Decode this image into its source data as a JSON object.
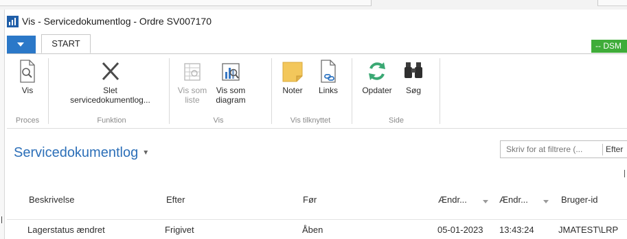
{
  "window": {
    "title": "Vis - Servicedokumentlog - Ordre SV007170"
  },
  "ribbon": {
    "tab": "START",
    "status_badge": "-- DSM",
    "buttons": {
      "vis": "Vis",
      "slet": "Slet servicedokumentlog...",
      "vis_som_liste": "Vis som liste",
      "vis_som_diagram": "Vis som diagram",
      "noter": "Noter",
      "links": "Links",
      "opdater": "Opdater",
      "soeg": "Søg"
    },
    "groups": {
      "proces": "Proces",
      "funktion": "Funktion",
      "vis": "Vis",
      "vis_tilknyttet": "Vis tilknyttet",
      "side": "Side"
    }
  },
  "page": {
    "title": "Servicedokumentlog",
    "title_caret": "▾"
  },
  "filter": {
    "placeholder": "Skriv for at filtrere (...",
    "field_label": "Efter"
  },
  "table": {
    "columns": {
      "beskrivelse": "Beskrivelse",
      "efter": "Efter",
      "foer": "Før",
      "aendr_date": "Ændr...",
      "aendr_time": "Ændr...",
      "bruger": "Bruger-id"
    },
    "rows": [
      {
        "beskrivelse": "Lagerstatus ændret",
        "efter": "Frigivet",
        "foer": "Åben",
        "dato": "05-01-2023",
        "tid": "13:43:24",
        "bruger": "JMATEST\\LRP"
      }
    ]
  },
  "colors": {
    "menu_button": "#2b78c8",
    "status_badge": "#3fac39",
    "page_title": "#2c6fb8",
    "refresh_icon": "#3aa873",
    "notes_icon": "#f3c75b"
  },
  "icons": [
    "app-icon",
    "menu-arrow-icon",
    "document-magnifier-icon",
    "delete-x-icon",
    "list-view-icon",
    "chart-view-icon",
    "note-icon",
    "link-document-icon",
    "refresh-icon",
    "binoculars-icon",
    "sort-arrow-icon"
  ]
}
